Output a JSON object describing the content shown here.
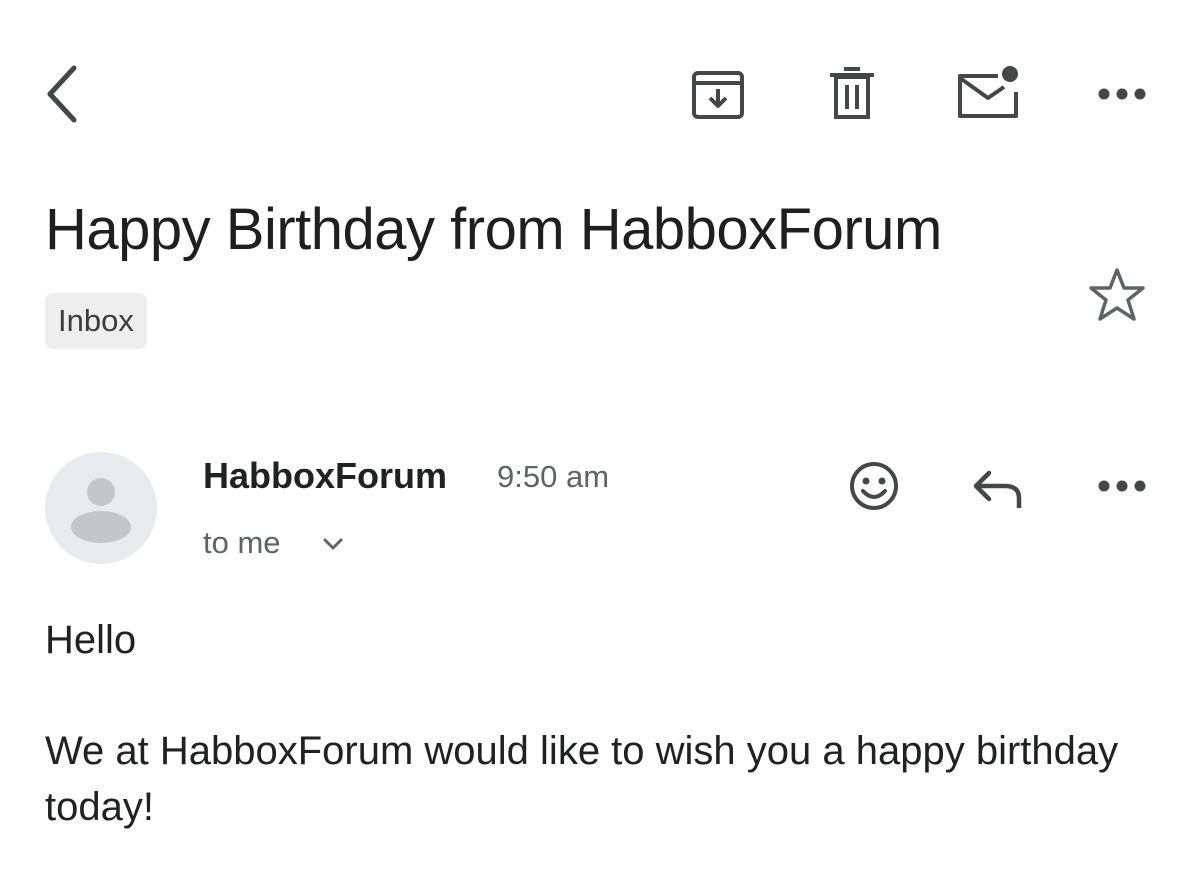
{
  "toolbar": {
    "back_icon": "chevron-left-icon",
    "archive_icon": "archive-icon",
    "delete_icon": "trash-icon",
    "mark_unread_icon": "mark-unread-icon",
    "more_icon": "more-horizontal-icon"
  },
  "thread": {
    "subject": "Happy Birthday from HabboxForum",
    "label": "Inbox",
    "star_icon": "star-outline-icon"
  },
  "message": {
    "avatar_icon": "default-avatar-icon",
    "sender": "HabboxForum",
    "time": "9:50 am",
    "recipient": "to me",
    "recipient_toggle_icon": "chevron-down-icon",
    "react_icon": "emoji-icon",
    "reply_icon": "reply-icon",
    "more_icon": "more-horizontal-icon",
    "greeting": "Hello",
    "body": "We at HabboxForum would like to wish you a happy birthday today!"
  },
  "colors": {
    "text": "#202124",
    "secondary_text": "#5f6368",
    "icon": "#444746",
    "chip_background": "#eeeeee",
    "avatar_background": "#e8eaed",
    "avatar_figure": "#c4c7c9"
  }
}
